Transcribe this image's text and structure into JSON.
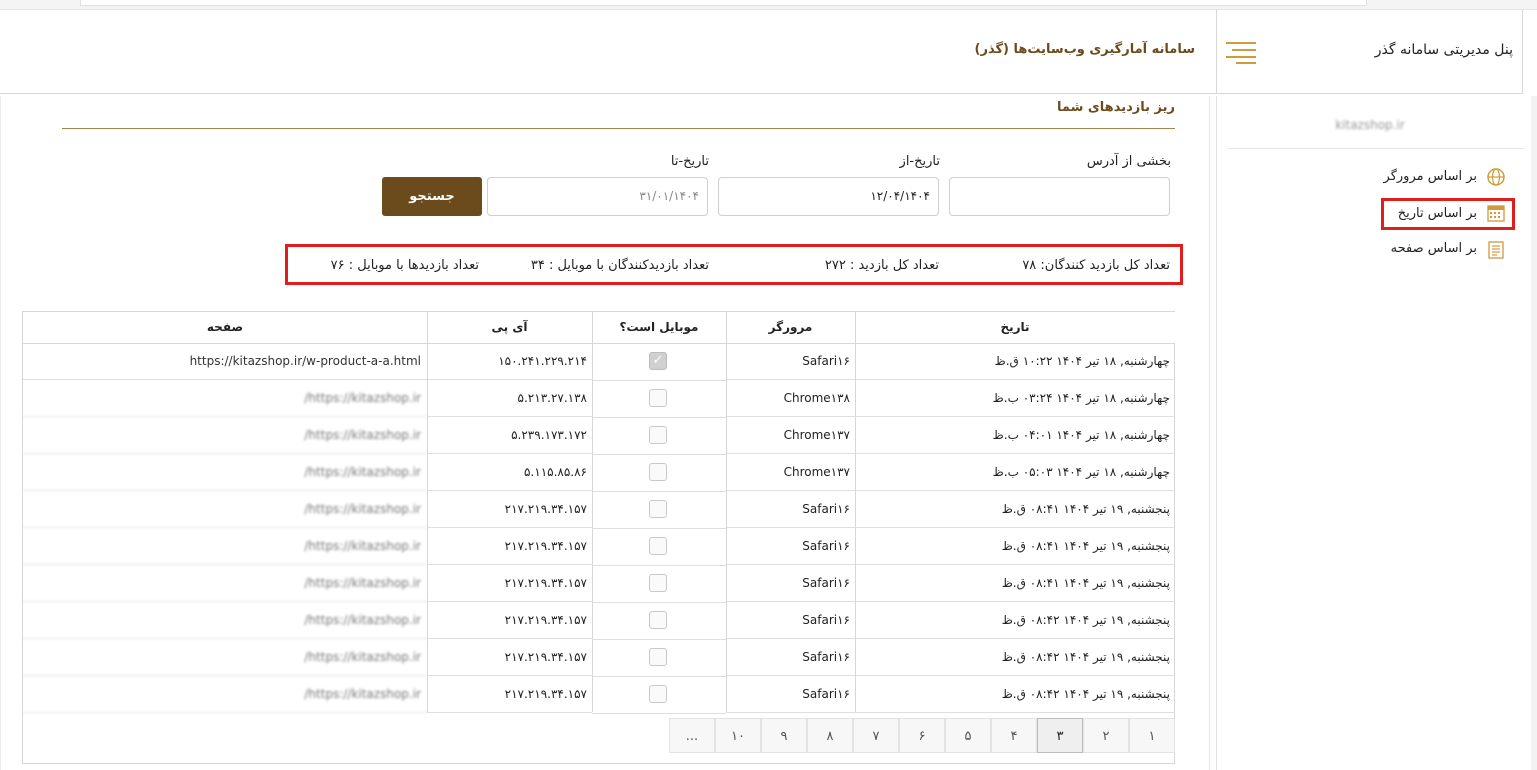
{
  "header": {
    "site_title": "سامانه آمارگیری وب‌سایت‌ها (گذر)",
    "brand": "پنل مدیریتی سامانه گذر"
  },
  "sidebar": {
    "domain": "kitazshop.ir",
    "items": [
      {
        "label": "بر اساس مرورگر",
        "icon": "globe-icon"
      },
      {
        "label": "بر اساس تاریخ",
        "icon": "calendar-icon"
      },
      {
        "label": "بر اساس صفحه",
        "icon": "document-icon"
      }
    ]
  },
  "section": {
    "title": "ریز بازدیدهای شما"
  },
  "filters": {
    "address_label": "بخشی از آدرس",
    "address_value": "",
    "from_label": "تاریخ-از",
    "from_value": "۱۲/۰۴/۱۴۰۴",
    "to_label": "تاریخ-تا",
    "to_value": "۳۱/۰۱/۱۴۰۴",
    "search_button": "جستجو"
  },
  "stats": {
    "total_visitors": "تعداد کل بازدید کنندگان: ۷۸",
    "total_visits": "تعداد کل بازدید : ۲۷۲",
    "mobile_visitors": "تعداد بازدیدکنندگان با موبایل : ۳۴",
    "mobile_visits": "تعداد بازدیدها با موبایل : ۷۶"
  },
  "table": {
    "headers": {
      "date": "تاریخ",
      "browser": "مرورگر",
      "mobile": "موبایل است؟",
      "ip": "آی پی",
      "page": "صفحه"
    },
    "rows": [
      {
        "date": "چهارشنبه, ۱۸ تیر ۱۴۰۴ ۱۰:۲۲ ق.ظ",
        "browser": "Safari۱۶",
        "mobile": true,
        "ip": "۱۵۰.۲۴۱.۲۲۹.۲۱۴",
        "page": "https://kitazshop.ir/w-product-a-a.html"
      },
      {
        "date": "چهارشنبه, ۱۸ تیر ۱۴۰۴ ۰۳:۲۴ ب.ظ",
        "browser": "Chrome۱۳۸",
        "mobile": false,
        "ip": "۵.۲۱۳.۲۷.۱۳۸",
        "page": "/https://kitazshop.ir"
      },
      {
        "date": "چهارشنبه, ۱۸ تیر ۱۴۰۴ ۰۴:۰۱ ب.ظ",
        "browser": "Chrome۱۳۷",
        "mobile": false,
        "ip": "۵.۲۳۹.۱۷۳.۱۷۲",
        "page": "/https://kitazshop.ir"
      },
      {
        "date": "چهارشنبه, ۱۸ تیر ۱۴۰۴ ۰۵:۰۳ ب.ظ",
        "browser": "Chrome۱۳۷",
        "mobile": false,
        "ip": "۵.۱۱۵.۸۵.۸۶",
        "page": "/https://kitazshop.ir"
      },
      {
        "date": "پنجشنبه, ۱۹ تیر ۱۴۰۴ ۰۸:۴۱ ق.ظ",
        "browser": "Safari۱۶",
        "mobile": false,
        "ip": "۲۱۷.۲۱۹.۳۴.۱۵۷",
        "page": "/https://kitazshop.ir"
      },
      {
        "date": "پنجشنبه, ۱۹ تیر ۱۴۰۴ ۰۸:۴۱ ق.ظ",
        "browser": "Safari۱۶",
        "mobile": false,
        "ip": "۲۱۷.۲۱۹.۳۴.۱۵۷",
        "page": "/https://kitazshop.ir"
      },
      {
        "date": "پنجشنبه, ۱۹ تیر ۱۴۰۴ ۰۸:۴۱ ق.ظ",
        "browser": "Safari۱۶",
        "mobile": false,
        "ip": "۲۱۷.۲۱۹.۳۴.۱۵۷",
        "page": "/https://kitazshop.ir"
      },
      {
        "date": "پنجشنبه, ۱۹ تیر ۱۴۰۴ ۰۸:۴۲ ق.ظ",
        "browser": "Safari۱۶",
        "mobile": false,
        "ip": "۲۱۷.۲۱۹.۳۴.۱۵۷",
        "page": "/https://kitazshop.ir"
      },
      {
        "date": "پنجشنبه, ۱۹ تیر ۱۴۰۴ ۰۸:۴۲ ق.ظ",
        "browser": "Safari۱۶",
        "mobile": false,
        "ip": "۲۱۷.۲۱۹.۳۴.۱۵۷",
        "page": "/https://kitazshop.ir"
      },
      {
        "date": "پنجشنبه, ۱۹ تیر ۱۴۰۴ ۰۸:۴۲ ق.ظ",
        "browser": "Safari۱۶",
        "mobile": false,
        "ip": "۲۱۷.۲۱۹.۳۴.۱۵۷",
        "page": "/https://kitazshop.ir"
      }
    ]
  },
  "pagination": {
    "pages": [
      "۱",
      "۲",
      "۳",
      "۴",
      "۵",
      "۶",
      "۷",
      "۸",
      "۹",
      "۱۰",
      "..."
    ],
    "active": "۳"
  },
  "colors": {
    "accent_brown": "#6b4a1c",
    "hamburger_gold": "#d19a3a",
    "highlight_red": "#e01e1e"
  }
}
